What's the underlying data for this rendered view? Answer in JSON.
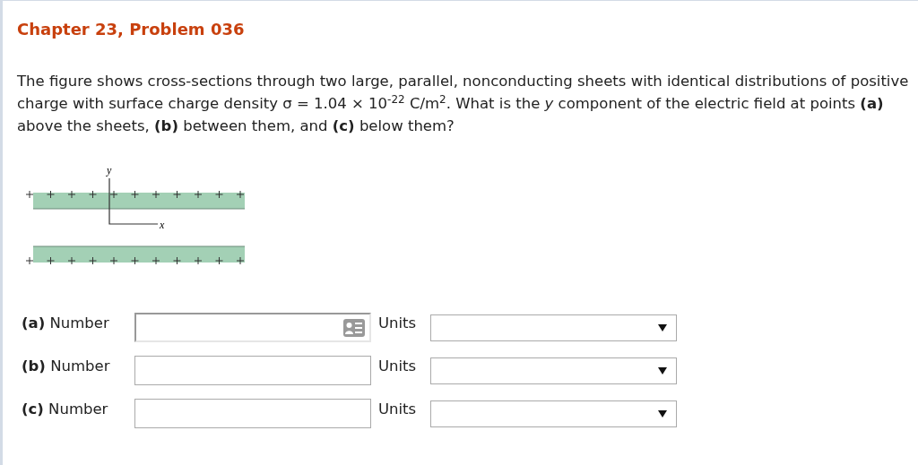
{
  "title": "Chapter 23, Problem 036",
  "question": "The figure shows cross-sections through two large, parallel, nonconducting sheets with identical distributions of positive charge with surface charge density σ = 1.04 × 10$^{-22}$ C/m$^{2}$. What is the *y* component of the electric field at points **(a)** above the sheets, **(b)** between them, and **(c)** below them?",
  "figure": {
    "axis_y_label": "y",
    "axis_x_label": "x"
  },
  "answers": [
    {
      "label": "**(a)** Number",
      "units_label": "Units",
      "focused": true
    },
    {
      "label": "**(b)** Number",
      "units_label": "Units",
      "focused": false
    },
    {
      "label": "**(c)** Number",
      "units_label": "Units",
      "focused": false
    }
  ]
}
